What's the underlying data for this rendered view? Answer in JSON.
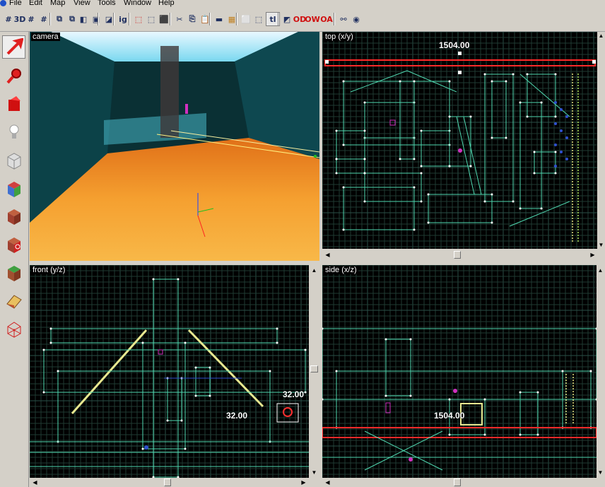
{
  "menu": [
    "File",
    "Edit",
    "Map",
    "View",
    "Tools",
    "Window",
    "Help"
  ],
  "toolbar_icons": [
    {
      "name": "grid-icon",
      "glyph": "#"
    },
    {
      "name": "3d-grid-icon",
      "glyph": "3D"
    },
    {
      "name": "snap-grid-icon",
      "glyph": "#"
    },
    {
      "name": "small-grid-icon",
      "glyph": "#"
    },
    {
      "name": "group-icon",
      "glyph": "⧉"
    },
    {
      "name": "ungroup-icon",
      "glyph": "⧉"
    },
    {
      "name": "brush-icon",
      "glyph": "◧"
    },
    {
      "name": "select-all-icon",
      "glyph": "▣"
    },
    {
      "name": "select-similar-icon",
      "glyph": "◪"
    },
    {
      "name": "ignore-icon",
      "glyph": "ig"
    },
    {
      "name": "cube-red-icon",
      "glyph": "⬚"
    },
    {
      "name": "cube-icon",
      "glyph": "⬚"
    },
    {
      "name": "cube-solid-icon",
      "glyph": "⬛"
    },
    {
      "name": "cut-icon",
      "glyph": "✂"
    },
    {
      "name": "copy-icon",
      "glyph": "⎘"
    },
    {
      "name": "paste-icon",
      "glyph": "📋"
    },
    {
      "name": "gray-block-icon",
      "glyph": "▬"
    },
    {
      "name": "texture-icon",
      "glyph": "▦"
    },
    {
      "name": "bounding-box-icon",
      "glyph": "⬜"
    },
    {
      "name": "vertex-select-icon",
      "glyph": "⬚"
    },
    {
      "name": "texture-lock-icon",
      "glyph": "tl"
    },
    {
      "name": "flip-icon",
      "glyph": "◩"
    },
    {
      "name": "od-icon",
      "glyph": "OD"
    },
    {
      "name": "ow-icon",
      "glyph": "OW"
    },
    {
      "name": "oa-icon",
      "glyph": "OA"
    },
    {
      "name": "link-icon",
      "glyph": "⚯"
    },
    {
      "name": "sphere-icon",
      "glyph": "◉"
    }
  ],
  "left_tools": [
    "select-arrow-icon",
    "magnify-icon",
    "paint-bucket-icon",
    "light-bulb-icon",
    "cube-tool-icon",
    "multi-texture-cube-icon",
    "brick-cube-icon",
    "target-cube-icon",
    "grass-cube-icon",
    "wedge-icon",
    "mesh-icon"
  ],
  "viewports": {
    "camera": {
      "label": "camera"
    },
    "top": {
      "label": "top (x/y)",
      "coord": "1504.00"
    },
    "front": {
      "label": "front (y/z)",
      "coord_a": "32.00",
      "coord_b": "32.00"
    },
    "side": {
      "label": "side (x/z)",
      "coord": "1504.00"
    }
  },
  "colors": {
    "grid_bg": "#000000",
    "grid_line": "#1f3a32",
    "brush_line": "#4fd8b0",
    "selection": "#ff2a2a",
    "floor": "#f09a20",
    "water": "#38c8d8"
  }
}
